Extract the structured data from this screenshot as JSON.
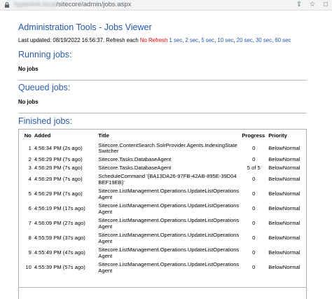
{
  "browser": {
    "url_host": "hyperlink.local",
    "url_path": "/sitecore/admin/jobs.aspx"
  },
  "header": {
    "admin_link": "Administration Tools",
    "separator": " - ",
    "page_title": "Jobs Viewer"
  },
  "status": {
    "last_updated_label": "Last updated: 08/19/2022 16:56:37. Refresh each ",
    "no_refresh": "No Refresh",
    "refresh_options": [
      "1 sec",
      "2 sec",
      "5 sec",
      "10 sec",
      "20 sec",
      "30 sec",
      "60 sec"
    ]
  },
  "running": {
    "title": "Running jobs:",
    "empty": "No jobs"
  },
  "queued": {
    "title": "Queued jobs:",
    "empty": "No jobs"
  },
  "finished": {
    "title": "Finished jobs:",
    "columns": [
      "No",
      "Added",
      "Title",
      "Progress",
      "Priority"
    ],
    "rows": [
      {
        "no": "1",
        "added": "4:56:34 PM (2s ago)",
        "title": "Sitecore.ContentSearch.SolrProvider.Agents.IndexingState Switcher",
        "progress": "0",
        "priority": "BelowNormal"
      },
      {
        "no": "2",
        "added": "4:56:29 PM (7s ago)",
        "title": "Sitecore.Tasks.DatabaseAgent",
        "progress": "0",
        "priority": "BelowNormal"
      },
      {
        "no": "3",
        "added": "4:56:29 PM (7s ago)",
        "title": "Sitecore.Tasks.DatabaseAgent",
        "progress": "5 of 5",
        "priority": "BelowNormal"
      },
      {
        "no": "4",
        "added": "4:56:29 PM (7s ago)",
        "title": "ScheduleCommand '{BA13DA26-97FB-42AB-895E-39D04 BEF19EB}'",
        "progress": "0",
        "priority": "BelowNormal"
      },
      {
        "no": "5",
        "added": "4:56:29 PM (7s ago)",
        "title": "Sitecore.ListManagement.Operations.UpdateListOperations Agent",
        "progress": "0",
        "priority": "BelowNormal"
      },
      {
        "no": "6",
        "added": "4:56:19 PM (17s ago)",
        "title": "Sitecore.ListManagement.Operations.UpdateListOperations Agent",
        "progress": "0",
        "priority": "BelowNormal"
      },
      {
        "no": "7",
        "added": "4:56:09 PM (27s ago)",
        "title": "Sitecore.ListManagement.Operations.UpdateListOperations Agent",
        "progress": "0",
        "priority": "BelowNormal"
      },
      {
        "no": "8",
        "added": "4:55:59 PM (37s ago)",
        "title": "Sitecore.ListManagement.Operations.UpdateListOperations Agent",
        "progress": "0",
        "priority": "BelowNormal"
      },
      {
        "no": "9",
        "added": "4:55:49 PM (47s ago)",
        "title": "Sitecore.ListManagement.Operations.UpdateListOperations Agent",
        "progress": "0",
        "priority": "BelowNormal"
      },
      {
        "no": "10",
        "added": "4:55:39 PM (57s ago)",
        "title": "Sitecore.ListManagement.Operations.UpdateListOperations Agent",
        "progress": "0",
        "priority": "BelowNormal"
      }
    ]
  },
  "colors": {
    "link": "#2255aa",
    "no_refresh": "#e60000",
    "rule": "#b8b8b8"
  }
}
